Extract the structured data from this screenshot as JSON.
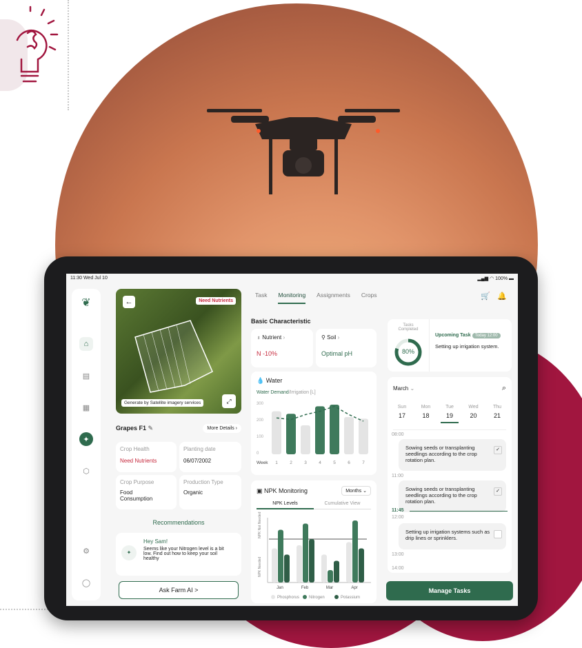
{
  "status": {
    "time": "11:30",
    "date": "Wed Jul 10",
    "battery": "100%"
  },
  "map": {
    "badge": "Need Nutrients",
    "note": "Generate by Satellite imagery services"
  },
  "crop": {
    "name": "Grapes F1",
    "more": "More Details",
    "health_label": "Crop Health",
    "health_value": "Need Nutrients",
    "planting_label": "Planting date",
    "planting_value": "06/07/2002",
    "purpose_label": "Crop Purpose",
    "purpose_value1": "Food",
    "purpose_value2": "Consumption",
    "production_label": "Production Type",
    "production_value": "Organic"
  },
  "recommendations": {
    "title": "Recommendations",
    "greet": "Hey Sam!",
    "text1": "Seems like your Nitrogen level is a bit",
    "text2": "low. Find out how to keep your soil",
    "text3": "healthy",
    "button": "Ask Farm AI  >"
  },
  "tabs": [
    "Task",
    "Monitoring",
    "Assignments",
    "Crops"
  ],
  "basic": {
    "title": "Basic Characteristic",
    "nutrient": "Nutrient",
    "nutrient_val": "N -10%",
    "soil": "Soil",
    "soil_val": "Optimal pH"
  },
  "water": {
    "title": "Water",
    "subtitle_a": "Water Demand",
    "subtitle_b": "/Irrigation [L]",
    "xlabel": "Week"
  },
  "chart_data": [
    {
      "type": "bar",
      "title": "Water",
      "ylabel": "",
      "xlabel": "Week",
      "categories": [
        "1",
        "2",
        "3",
        "4",
        "5",
        "6",
        "7"
      ],
      "yticks": [
        "300",
        "200",
        "100",
        "0"
      ],
      "ylim": [
        0,
        300
      ],
      "series": [
        {
          "values": [
            260,
            245,
            175,
            290,
            300,
            225,
            215
          ]
        }
      ],
      "line": [
        220,
        210,
        240,
        260,
        290,
        240,
        200
      ]
    },
    {
      "type": "bar",
      "title": "NPK Monitoring",
      "categories": [
        "Jan",
        "Feb",
        "Mar",
        "Apr"
      ],
      "series": [
        {
          "name": "Phosphorus",
          "values": [
            55,
            60,
            45,
            65
          ]
        },
        {
          "name": "Nitrogen",
          "values": [
            85,
            95,
            20,
            100
          ]
        },
        {
          "name": "Potassium",
          "values": [
            45,
            70,
            35,
            55
          ]
        }
      ],
      "threshold": 70
    }
  ],
  "npk": {
    "title": "NPK Monitoring",
    "period": "Months",
    "tab1": "NPK Levels",
    "tab2": "Cumulative View",
    "ylabel_top": "NPK Not Needed",
    "ylabel_bottom": "NPK Needed"
  },
  "tasks": {
    "completed_label": "Tasks Completed",
    "percent": "80%",
    "upcoming": "Upcoming Task",
    "time": "Today 12:00",
    "desc": "Setting up irrigation system."
  },
  "calendar": {
    "month": "March",
    "days": [
      {
        "d": "Sun",
        "n": "17"
      },
      {
        "d": "Mon",
        "n": "18"
      },
      {
        "d": "Tue",
        "n": "19"
      },
      {
        "d": "Wed",
        "n": "20"
      },
      {
        "d": "Thu",
        "n": "21"
      }
    ],
    "times": [
      "08:00",
      "11:00",
      "12:00",
      "13:00",
      "14:00"
    ],
    "now": "11:45",
    "events": [
      "Sowing seeds or transplanting seedlings according to the crop rotation plan.",
      "Sowing seeds or transplanting seedlings according to the crop rotation plan.",
      "Setting up irrigation systems such as drip lines or sprinklers."
    ]
  },
  "manage": "Manage Tasks"
}
